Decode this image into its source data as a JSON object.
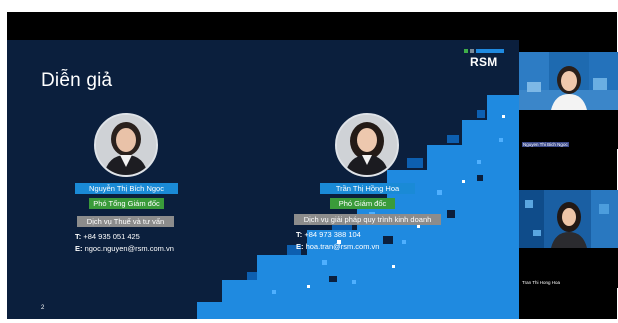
{
  "slide": {
    "title": "Diễn giả",
    "logo_text": "RSM",
    "page_number": "2",
    "speakers": [
      {
        "name": "Nguyễn Thị Bích Ngọc",
        "role": "Phó Tổng Giám đốc",
        "department": "Dịch vụ Thuế và tư vấn",
        "phone_label": "T:",
        "phone": "+84 935 051 425",
        "email_label": "E:",
        "email": "ngoc.nguyen@rsm.com.vn"
      },
      {
        "name": "Trần Thị Hồng Hoa",
        "role": "Phó Giám đốc",
        "department": "Dịch vụ giải pháp quy trình kinh doanh",
        "phone_label": "T:",
        "phone": "+84 973 388 104",
        "email_label": "E:",
        "email": "hoa.tran@rsm.com.vn"
      }
    ]
  },
  "participants": [
    {
      "name": "Nguyen Thi Bich Ngoc"
    },
    {
      "name": "Tran Thi Hong Hoa"
    }
  ],
  "colors": {
    "slide_bg": "#0b1f3d",
    "accent_blue": "#1a8ad6",
    "role_green": "#3a9b3a",
    "dept_gray": "#8c8c8c",
    "logo_green": "#3fae49"
  },
  "icons": {
    "logo": "rsm-logo-icon",
    "avatar": "person-avatar-icon"
  }
}
